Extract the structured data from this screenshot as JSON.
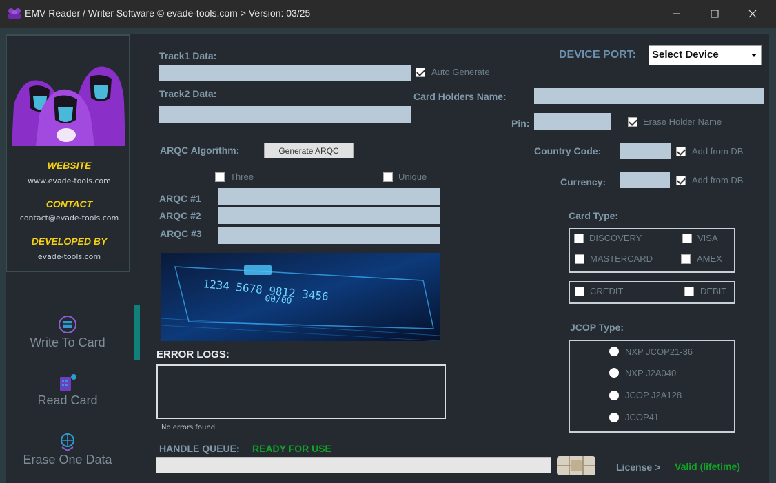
{
  "window": {
    "title": "EMV Reader / Writer Software © evade-tools.com > Version: 03/25"
  },
  "sidebar": {
    "website_heading": "WEBSITE",
    "website_value": "www.evade-tools.com",
    "contact_heading": "CONTACT",
    "contact_value": "contact@evade-tools.com",
    "developer_heading": "DEVELOPED BY",
    "developer_value": "evade-tools.com",
    "nav": {
      "write": "Write To Card",
      "read": "Read Card",
      "erase": "Erase One Data"
    }
  },
  "tracks": {
    "track1_label": "Track1 Data:",
    "track2_label": "Track2 Data:",
    "auto_generate": "Auto Generate"
  },
  "arqc": {
    "algorithm_label": "ARQC Algorithm:",
    "generate_button": "Generate ARQC",
    "three": "Three",
    "unique": "Unique",
    "arqc1": "ARQC #1",
    "arqc2": "ARQC #2",
    "arqc3": "ARQC #3"
  },
  "errors": {
    "heading": "ERROR LOGS:",
    "status": "No errors found."
  },
  "queue": {
    "label": "HANDLE QUEUE:",
    "status": "READY FOR USE"
  },
  "license": {
    "label": "License >",
    "status": "Valid (lifetime)"
  },
  "device": {
    "label": "DEVICE PORT:",
    "selected": "Select Device"
  },
  "holder": {
    "name_label": "Card Holders Name:",
    "pin_label": "Pin:",
    "erase_holder": "Erase Holder Name",
    "country_label": "Country Code:",
    "currency_label": "Currency:",
    "add_from_db_1": "Add from DB",
    "add_from_db_2": "Add from DB"
  },
  "card_type": {
    "label": "Card Type:",
    "discovery": "DISCOVERY",
    "visa": "VISA",
    "mastercard": "MASTERCARD",
    "amex": "AMEX",
    "credit": "CREDIT",
    "debit": "DEBIT"
  },
  "jcop": {
    "label": "JCOP Type:",
    "options": [
      "NXP JCOP21-36",
      "NXP J2A040",
      "JCOP J2A128",
      "JCOP41"
    ]
  },
  "card_image": {
    "number_line1": "1234 5678 9812 3456",
    "number_line2": "00/00"
  },
  "colors": {
    "accent": "#10807a",
    "heading_yellow": "#f5d013",
    "ok_green": "#11a326"
  }
}
